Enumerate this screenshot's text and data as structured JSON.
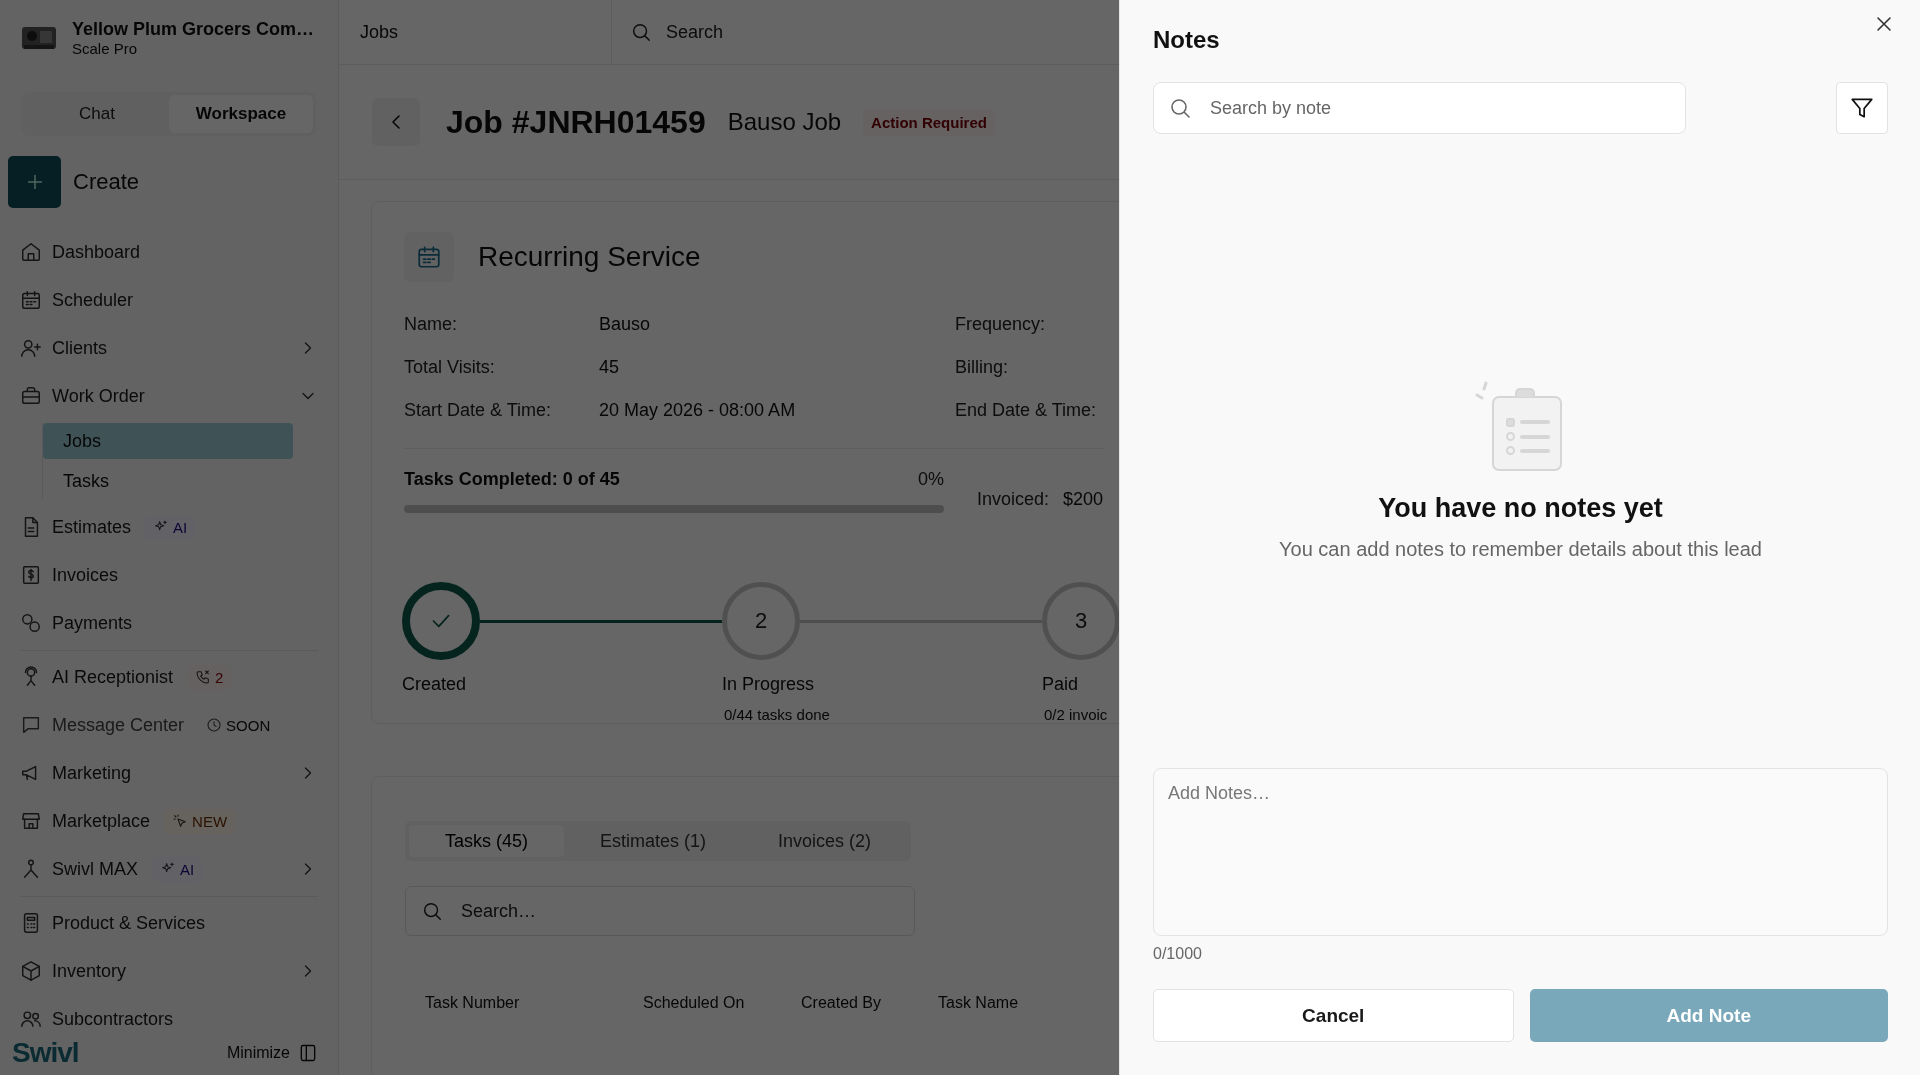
{
  "sidebar": {
    "company": "Yellow Plum Grocers Com…",
    "plan": "Scale Pro",
    "mode_tabs": [
      {
        "label": "Chat",
        "selected": false
      },
      {
        "label": "Workspace",
        "selected": true
      }
    ],
    "create_label": "Create",
    "nav_groups": [
      [
        {
          "label": "Dashboard",
          "selected": false,
          "disabled": false
        },
        {
          "label": "Scheduler",
          "selected": false,
          "disabled": false
        },
        {
          "label": "Clients",
          "selected": false,
          "disabled": false,
          "expanded": false
        },
        {
          "label": "Work Order",
          "selected": false,
          "disabled": false,
          "expanded": true,
          "children": [
            {
              "label": "Jobs",
              "selected": true
            },
            {
              "label": "Tasks",
              "selected": false
            }
          ]
        },
        {
          "label": "Estimates",
          "selected": false,
          "disabled": false,
          "badge": {
            "kind": "ai",
            "text": "AI"
          }
        },
        {
          "label": "Invoices",
          "selected": false,
          "disabled": false
        },
        {
          "label": "Payments",
          "selected": false,
          "disabled": false
        }
      ],
      [
        {
          "label": "AI Receptionist",
          "selected": false,
          "disabled": false,
          "badge": {
            "kind": "calls",
            "text": "2"
          }
        },
        {
          "label": "Message Center",
          "selected": false,
          "disabled": true,
          "badge": {
            "kind": "soon",
            "text": "SOON"
          }
        },
        {
          "label": "Marketing",
          "selected": false,
          "disabled": false,
          "expanded": false
        },
        {
          "label": "Marketplace",
          "selected": false,
          "disabled": false,
          "badge": {
            "kind": "new",
            "text": "NEW"
          }
        },
        {
          "label": "Swivl MAX",
          "selected": false,
          "disabled": false,
          "expanded": false,
          "badge": {
            "kind": "ai",
            "text": "AI"
          }
        }
      ],
      [
        {
          "label": "Product & Services",
          "selected": false,
          "disabled": false
        },
        {
          "label": "Inventory",
          "selected": false,
          "disabled": false,
          "expanded": false
        },
        {
          "label": "Subcontractors",
          "selected": false,
          "disabled": false
        }
      ]
    ],
    "brand": "Swivl",
    "minimize_label": "Minimize"
  },
  "topbar": {
    "breadcrumb": "Jobs",
    "search_placeholder": "Search"
  },
  "job": {
    "title": "Job #JNRH01459",
    "name": "Bauso Job",
    "status": "Action Required"
  },
  "service": {
    "title": "Recurring Service",
    "fields": [
      {
        "label": "Name:",
        "value": "Bauso"
      },
      {
        "label": "Total Visits:",
        "value": "45"
      },
      {
        "label": "Start Date & Time:",
        "value": "20 May 2026 - 08:00 AM"
      }
    ],
    "side_fields": [
      "Frequency:",
      "Billing:",
      "End Date & Time:"
    ],
    "progress": {
      "label": "Tasks Completed: 0 of 45",
      "percent": "0%",
      "level": 0
    },
    "invoiced": {
      "label": "Invoiced:",
      "value": "$200"
    }
  },
  "steps": [
    {
      "label": "Created",
      "completed": true
    },
    {
      "number": "2",
      "label": "In Progress",
      "detail": "0/44 tasks done",
      "completed": false
    },
    {
      "number": "3",
      "label": "Paid",
      "detail": "0/2 invoic",
      "completed": false
    }
  ],
  "tabs": [
    {
      "label": "Tasks (45)",
      "selected": true
    },
    {
      "label": "Estimates (1)",
      "selected": false
    },
    {
      "label": "Invoices (2)",
      "selected": false
    }
  ],
  "task_search": {
    "placeholder": "Search…"
  },
  "table": {
    "columns": [
      "Task Number",
      "Scheduled On",
      "Created By",
      "Task Name"
    ]
  },
  "notes": {
    "title": "Notes",
    "search_placeholder": "Search by note",
    "empty_title": "You have no notes yet",
    "empty_text": "You can add notes to remember details about this lead",
    "note_placeholder": "Add Notes…",
    "counter": "0/1000",
    "cancel": "Cancel",
    "submit": "Add Note",
    "submit_disabled": true
  }
}
